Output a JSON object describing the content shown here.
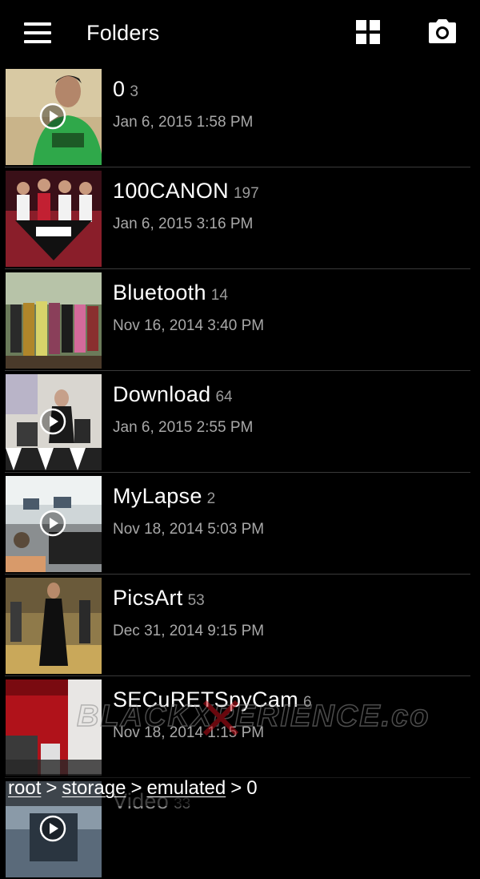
{
  "toolbar": {
    "menu_icon": "hamburger-menu-icon",
    "title": "Folders",
    "grid_icon": "grid-view-icon",
    "camera_icon": "camera-icon"
  },
  "folders": [
    {
      "name": "0",
      "count": "3",
      "date": "Jan 6, 2015 1:58 PM",
      "has_video": true
    },
    {
      "name": "100CANON",
      "count": "197",
      "date": "Jan 6, 2015 3:16 PM",
      "has_video": false
    },
    {
      "name": "Bluetooth",
      "count": "14",
      "date": "Nov 16, 2014 3:40 PM",
      "has_video": false
    },
    {
      "name": "Download",
      "count": "64",
      "date": "Jan 6, 2015 2:55 PM",
      "has_video": true
    },
    {
      "name": "MyLapse",
      "count": "2",
      "date": "Nov 18, 2014 5:03 PM",
      "has_video": true
    },
    {
      "name": "PicsArt",
      "count": "53",
      "date": "Dec 31, 2014 9:15 PM",
      "has_video": false
    },
    {
      "name": "SECuRETSpyCam",
      "count": "6",
      "date": "Nov 18, 2014 1:15 PM",
      "has_video": false
    },
    {
      "name": "Video",
      "count": "33",
      "date": "",
      "has_video": true
    }
  ],
  "breadcrumb": {
    "items": [
      "root",
      "storage",
      "emulated",
      "0"
    ],
    "separator": ">"
  },
  "watermark": "BLACKXPERIENCE.com",
  "colors": {
    "background": "#000000",
    "text_primary": "#ffffff",
    "text_secondary": "#a8a8a8",
    "divider": "#3a3a3a"
  }
}
